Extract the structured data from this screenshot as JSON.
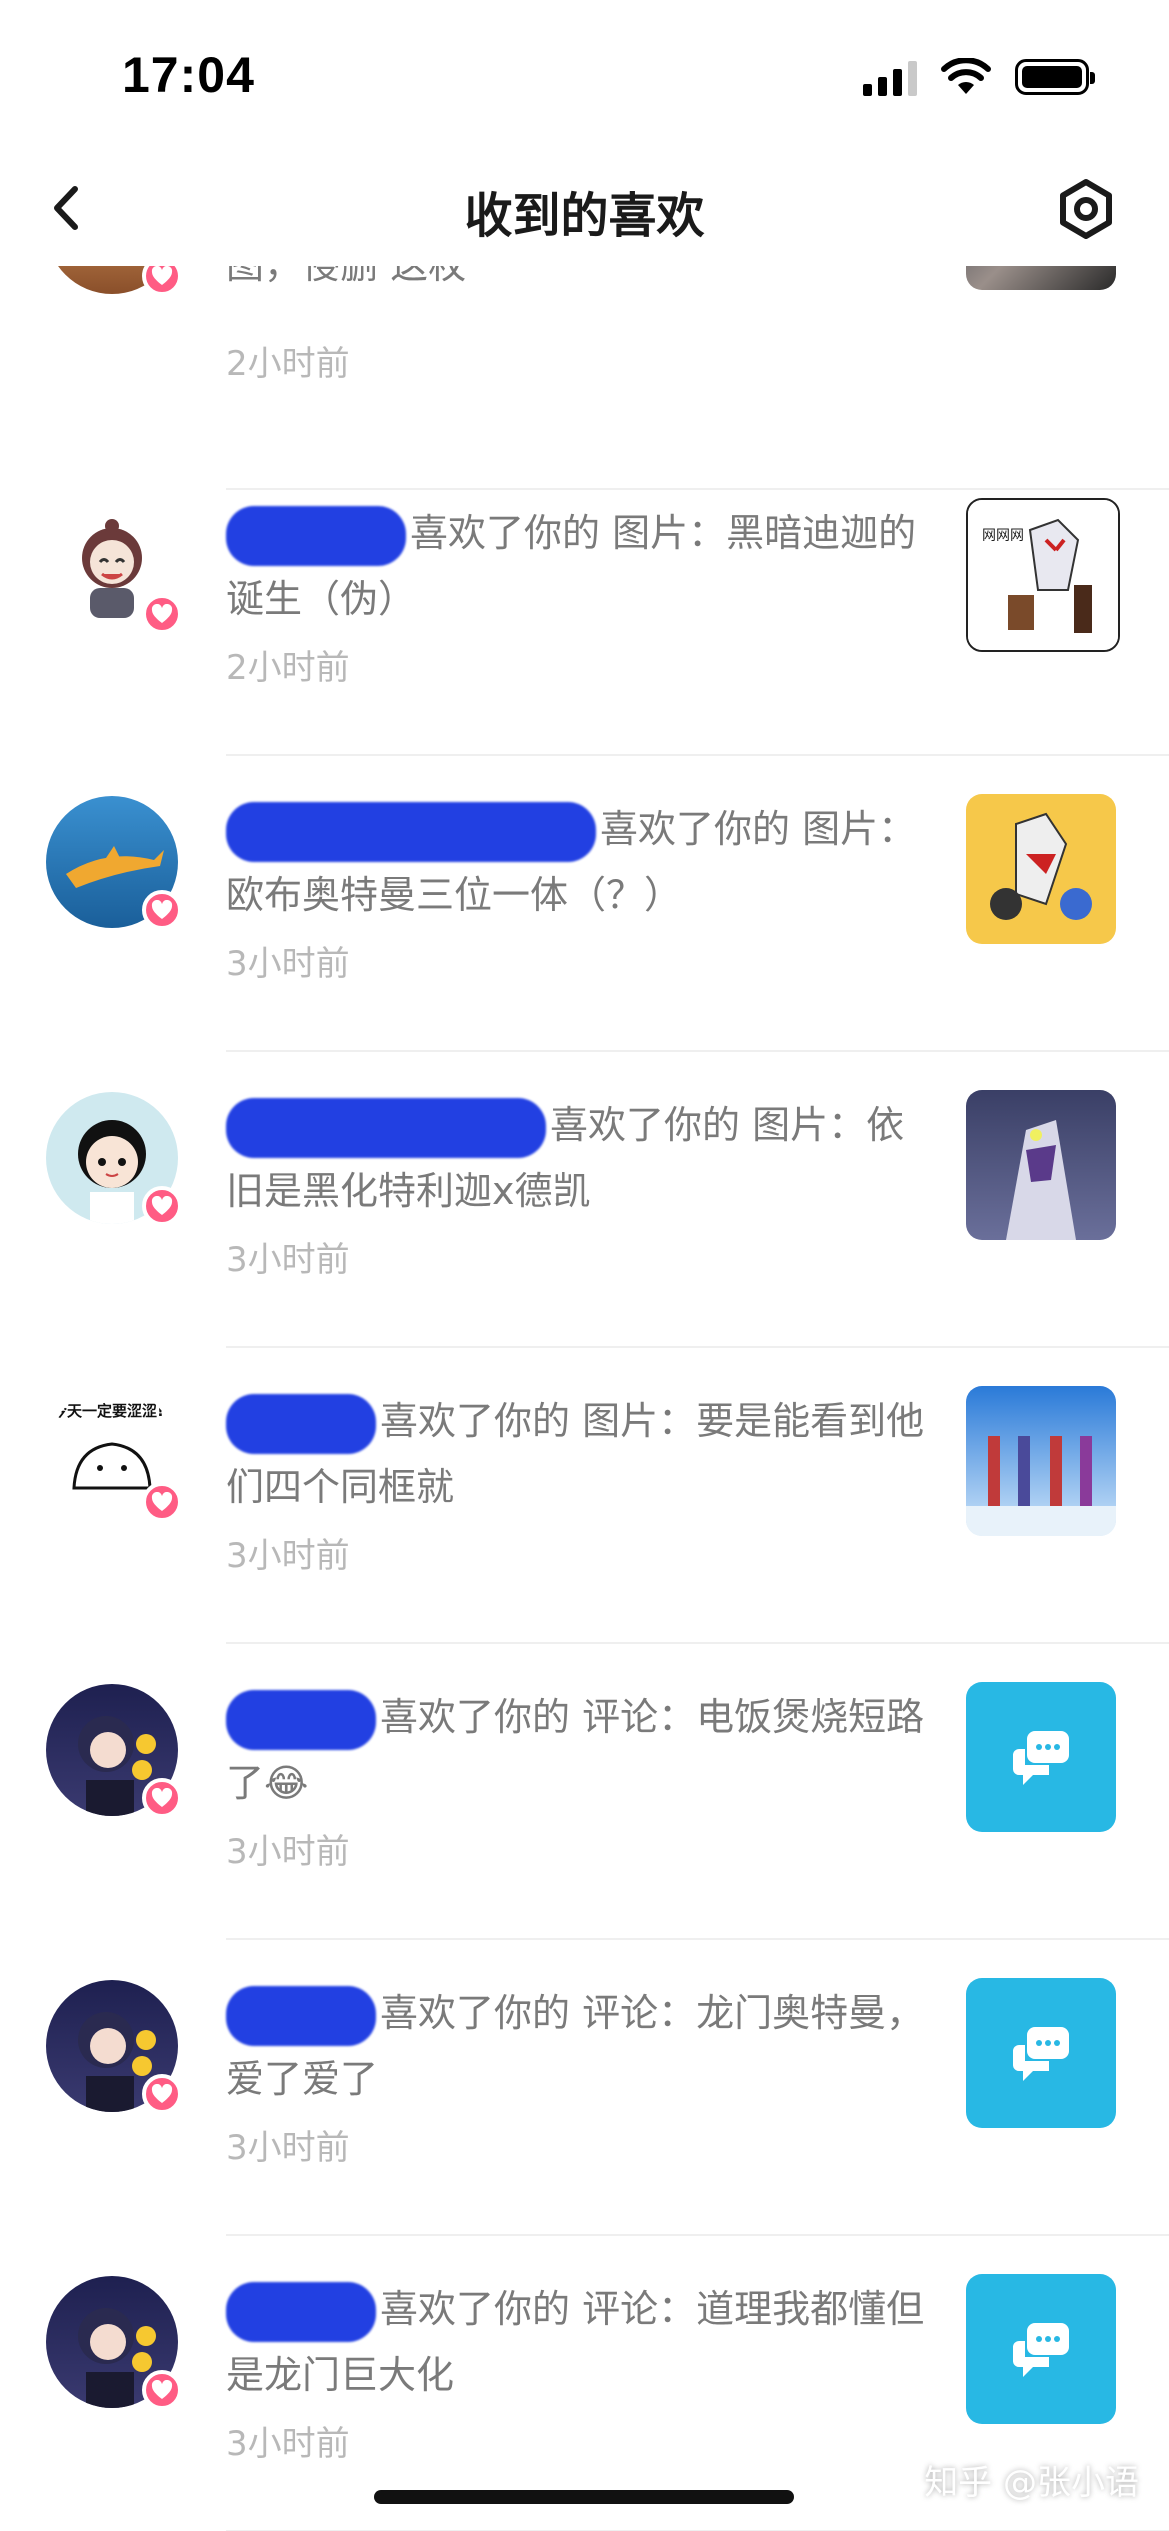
{
  "status_bar": {
    "time": "17:04"
  },
  "nav": {
    "title": "收到的喜欢"
  },
  "items": [
    {
      "text": "图，侵删 这枚",
      "time": "2小时前"
    },
    {
      "action": "喜欢了你的 图片：黑暗迪迦的诞生（伪）",
      "time": "2小时前",
      "thumb_label": "网网网"
    },
    {
      "action": "喜欢了你的 图片：欧布奥特曼三位一体（？）",
      "time": "3小时前"
    },
    {
      "action": "喜欢了你的 图片：依旧是黑化特利迦x德凯",
      "time": "3小时前"
    },
    {
      "action": "喜欢了你的 图片：要是能看到他们四个同框就",
      "time": "3小时前",
      "avatar_caption": "今天一定要涩涩!"
    },
    {
      "action": "喜欢了你的 评论：电饭煲烧短路了😂",
      "time": "3小时前"
    },
    {
      "action": "喜欢了你的 评论：龙门奥特曼，爱了爱了",
      "time": "3小时前"
    },
    {
      "action": "喜欢了你的 评论：道理我都懂但是龙门巨大化",
      "time": "3小时前"
    }
  ],
  "watermark": "知乎 @张小语",
  "colors": {
    "heart": "#ff5c84",
    "comment_thumb": "#28b8e4",
    "redaction": "#1030e0"
  }
}
